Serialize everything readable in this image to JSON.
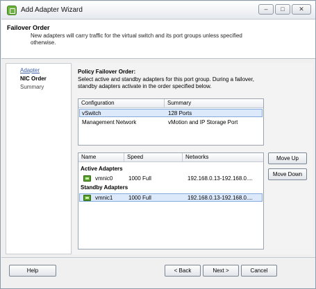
{
  "window": {
    "title": "Add Adapter Wizard",
    "controls": {
      "minimize": "–",
      "maximize": "□",
      "close": "✕"
    }
  },
  "header": {
    "title": "Failover Order",
    "description": "New adapters will carry traffic for the virtual switch and its port groups unless specified otherwise."
  },
  "steps": [
    {
      "label": "Adapter",
      "state": "done"
    },
    {
      "label": "NIC Order",
      "state": "current"
    },
    {
      "label": "Summary",
      "state": "future"
    }
  ],
  "policy": {
    "title": "Policy Failover Order:",
    "description": "Select active and standby adapters for this port group. During a failover, standby adapters activate in the order specified below."
  },
  "portgroup_table": {
    "columns": [
      "Configuration",
      "Summary"
    ],
    "rows": [
      {
        "configuration": "vSwitch",
        "summary": "128 Ports",
        "selected": true
      },
      {
        "configuration": "Management Network",
        "summary": "vMotion and IP Storage Port",
        "selected": false
      }
    ]
  },
  "adapter_table": {
    "columns": [
      "Name",
      "Speed",
      "Networks"
    ],
    "active_label": "Active Adapters",
    "standby_label": "Standby Adapters",
    "active": [
      {
        "name": "vmnic0",
        "speed": "1000 Full",
        "networks": "192.168.0.13-192.168.0....",
        "icon": "nic-icon"
      }
    ],
    "standby": [
      {
        "name": "vmnic1",
        "speed": "1000 Full",
        "networks": "192.168.0.13-192.168.0....",
        "icon": "nic-icon",
        "selected": true
      }
    ]
  },
  "side_buttons": {
    "move_up": "Move Up",
    "move_down": "Move Down"
  },
  "footer": {
    "help": "Help",
    "back": "< Back",
    "next": "Next >",
    "cancel": "Cancel"
  },
  "colors": {
    "selection": "#dce9fb",
    "selection_border": "#83a9dd",
    "nic_green": "#5aa02c",
    "link": "#3b5ea8"
  }
}
